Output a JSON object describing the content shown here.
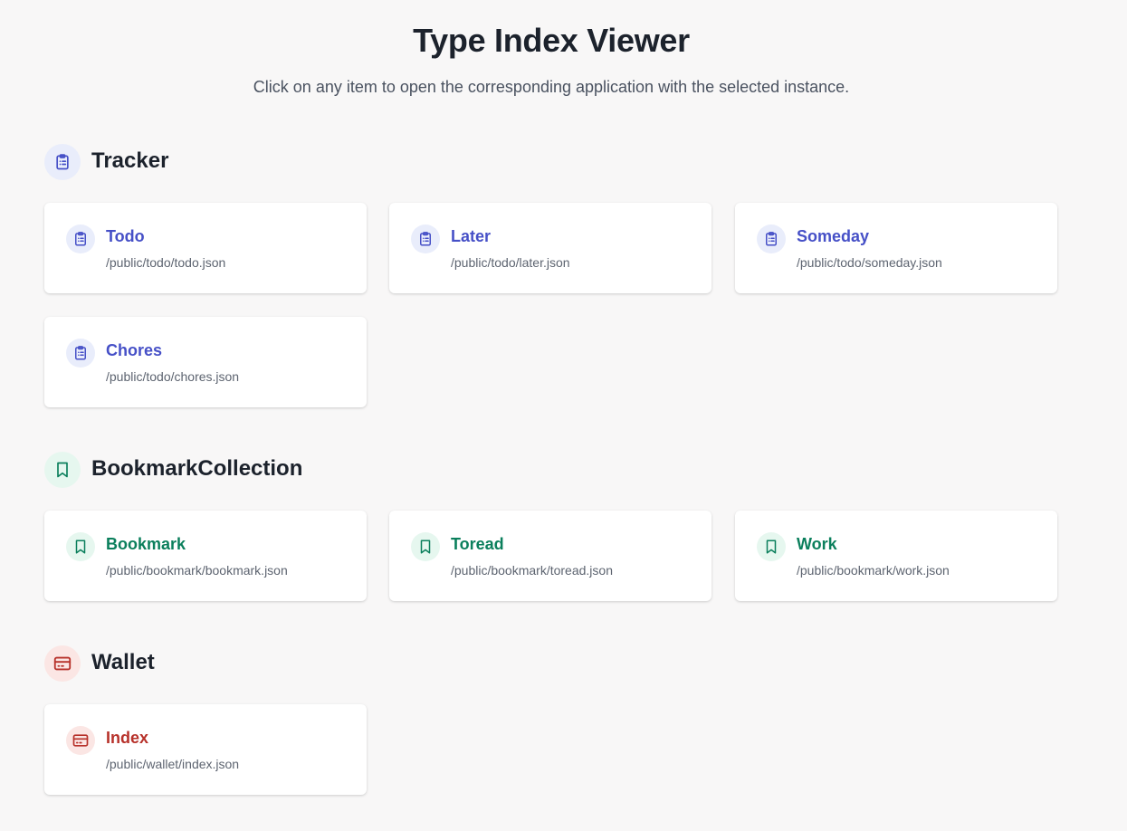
{
  "header": {
    "title": "Type Index Viewer",
    "subtitle": "Click on any item to open the corresponding application with the selected instance."
  },
  "colors": {
    "tracker": "#4650c7",
    "bookmark": "#0b7f5c",
    "wallet": "#b7312a",
    "background": "#f8f7f7"
  },
  "sections": [
    {
      "title": "Tracker",
      "icon": "clipboard-list-icon",
      "items": [
        {
          "label": "Todo",
          "path": "/public/todo/todo.json"
        },
        {
          "label": "Later",
          "path": "/public/todo/later.json"
        },
        {
          "label": "Someday",
          "path": "/public/todo/someday.json"
        },
        {
          "label": "Chores",
          "path": "/public/todo/chores.json"
        }
      ]
    },
    {
      "title": "BookmarkCollection",
      "icon": "bookmark-icon",
      "items": [
        {
          "label": "Bookmark",
          "path": "/public/bookmark/bookmark.json"
        },
        {
          "label": "Toread",
          "path": "/public/bookmark/toread.json"
        },
        {
          "label": "Work",
          "path": "/public/bookmark/work.json"
        }
      ]
    },
    {
      "title": "Wallet",
      "icon": "credit-card-icon",
      "items": [
        {
          "label": "Index",
          "path": "/public/wallet/index.json"
        }
      ]
    }
  ]
}
